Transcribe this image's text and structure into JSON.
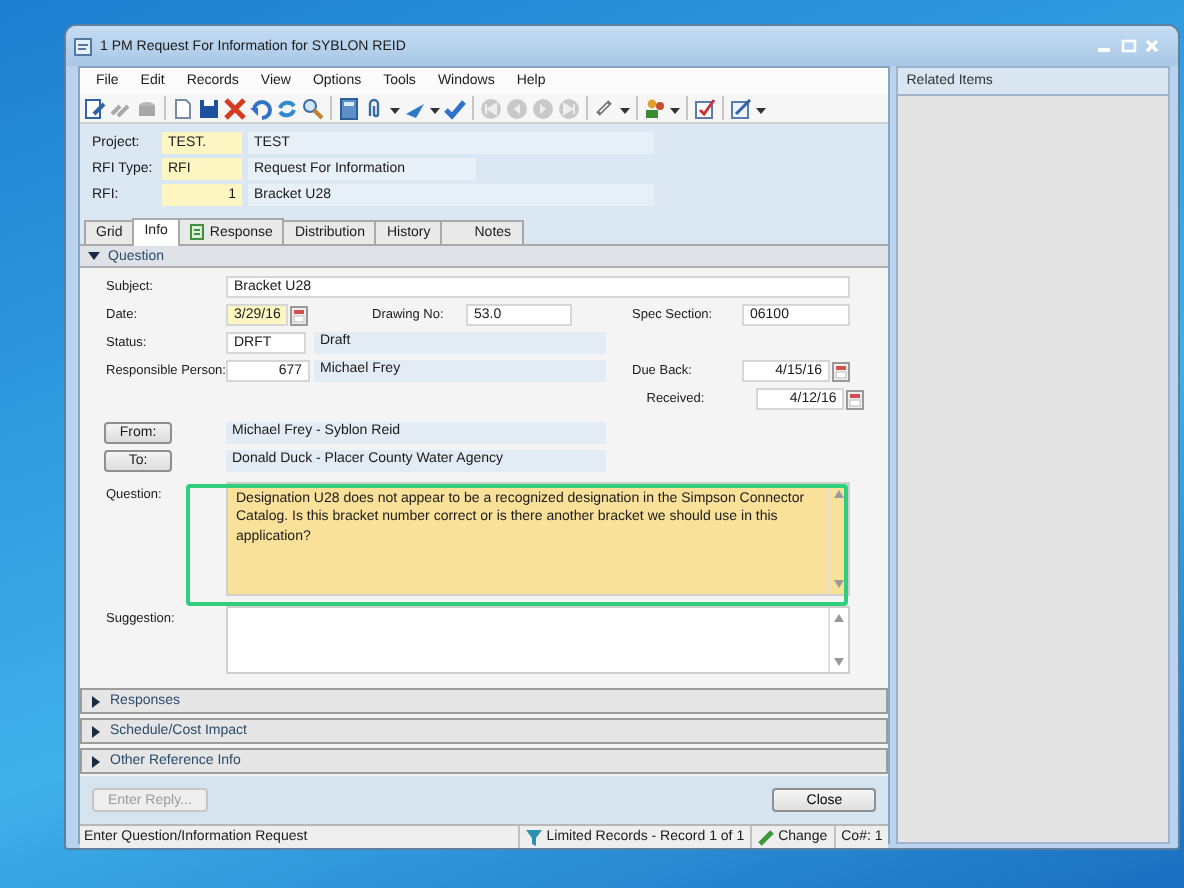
{
  "window": {
    "title": "1 PM Request For Information for SYBLON REID"
  },
  "menu": [
    "File",
    "Edit",
    "Records",
    "View",
    "Options",
    "Tools",
    "Windows",
    "Help"
  ],
  "header": [
    {
      "label": "Project:",
      "code": "TEST.",
      "description": "TEST"
    },
    {
      "label": "RFI Type:",
      "code": "RFI",
      "description": "Request For Information"
    },
    {
      "label": "RFI:",
      "code": "1",
      "description": "Bracket U28"
    }
  ],
  "tabs": [
    {
      "label": "Grid",
      "selected": false
    },
    {
      "label": "Info",
      "selected": true
    },
    {
      "label": "Response",
      "selected": false
    },
    {
      "label": "Distribution",
      "selected": false
    },
    {
      "label": "History",
      "selected": false
    },
    {
      "label": "Notes",
      "selected": false
    }
  ],
  "question_section": {
    "title": "Question",
    "expanded": true,
    "subject": {
      "label": "Subject:",
      "value": "Bracket U28"
    },
    "date": {
      "label": "Date:",
      "value": "3/29/16"
    },
    "drawing_no": {
      "label": "Drawing No:",
      "value": "53.0"
    },
    "spec_section": {
      "label": "Spec Section:",
      "value": "06100"
    },
    "status": {
      "label": "Status:",
      "code": "DRFT",
      "description": "Draft"
    },
    "responsible_person": {
      "label": "Responsible Person:",
      "id": "677",
      "name": "Michael Frey"
    },
    "due_back": {
      "label": "Due Back:",
      "value": "4/15/16"
    },
    "received": {
      "label": "Received:",
      "value": "4/12/16"
    },
    "from": {
      "button": "From:",
      "value": "Michael Frey - Syblon Reid"
    },
    "to": {
      "button": "To:",
      "value": "Donald Duck - Placer County Water Agency"
    },
    "question": {
      "label": "Question:",
      "value": "Designation U28 does not appear to be a recognized designation in the Simpson Connector Catalog.  Is this bracket number correct or is there another bracket we should use in this application?"
    },
    "suggestion": {
      "label": "Suggestion:"
    }
  },
  "sections": [
    {
      "title": "Responses",
      "expanded": false
    },
    {
      "title": "Schedule/Cost Impact",
      "expanded": false
    },
    {
      "title": "Other Reference Info",
      "expanded": false
    }
  ],
  "buttons": {
    "enter_reply": {
      "label": "Enter Reply...",
      "disabled": true
    },
    "close": {
      "label": "Close",
      "disabled": false
    }
  },
  "status_bar": {
    "message": "Enter Question/Information Request",
    "records": "Limited Records - Record 1 of 1",
    "mode": "Change",
    "company": "Co#: 1"
  },
  "related_panel": {
    "title": "Related Items"
  }
}
